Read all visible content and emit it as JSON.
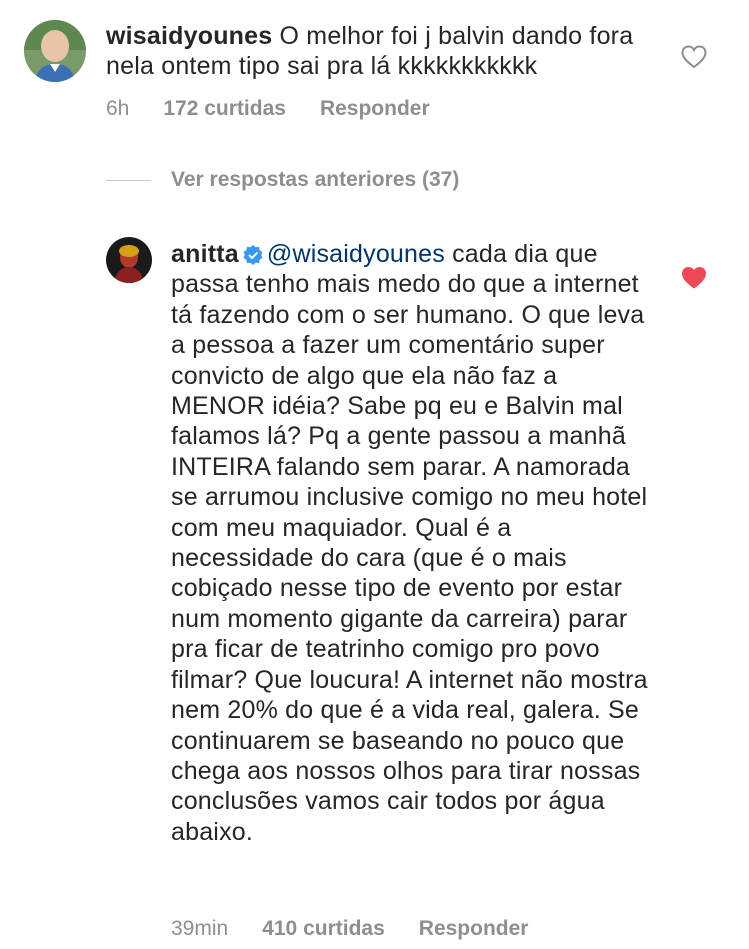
{
  "comments": [
    {
      "username": "wisaidyounes",
      "text": "O melhor foi j balvin dando fora nela ontem tipo sai pra lá kkkkkkkkkkk",
      "time": "6h",
      "likes": "172 curtidas",
      "reply_label": "Responder",
      "liked": false
    },
    {
      "username": "anitta",
      "verified": true,
      "mention": "@wisaidyounes",
      "text": "cada dia que passa tenho mais medo do que a internet tá fazendo com o ser humano. O que leva a pessoa a fazer um comentário super convicto de algo que ela não faz a MENOR idéia? Sabe pq eu e Balvin mal falamos lá? Pq a gente passou a manhã INTEIRA falando sem parar. A namorada se arrumou inclusive comigo no meu hotel com meu maquiador. Qual é a necessidade do cara (que é o mais cobiçado nesse tipo de evento por estar num momento gigante da carreira) parar pra ficar de teatrinho comigo pro povo filmar? Que loucura! A internet não mostra nem 20% do que é a vida real, galera. Se continuarem se baseando no pouco que chega aos nossos olhos para tirar nossas conclusões vamos cair todos por água abaixo.",
      "time": "39min",
      "likes": "410 curtidas",
      "reply_label": "Responder",
      "liked": true
    }
  ],
  "view_replies": "Ver respostas anteriores (37)",
  "colors": {
    "liked_heart": "#ed4956",
    "meta": "#8e8e8e",
    "mention": "#003569",
    "verified": "#3897f0"
  },
  "icons": {
    "like": "heart-icon",
    "verified": "verified-badge-icon"
  }
}
